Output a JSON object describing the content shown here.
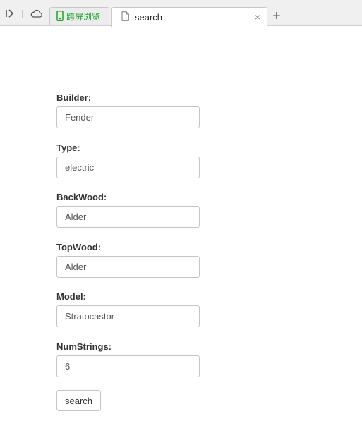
{
  "browser": {
    "qr_tab_label": "跨屏浏览",
    "active_tab_title": "search",
    "close_glyph": "×",
    "new_tab_glyph": "+"
  },
  "form": {
    "fields": [
      {
        "label": "Builder:",
        "value": "Fender"
      },
      {
        "label": "Type:",
        "value": "electric"
      },
      {
        "label": "BackWood:",
        "value": "Alder"
      },
      {
        "label": "TopWood:",
        "value": "Alder"
      },
      {
        "label": "Model:",
        "value": "Stratocastor"
      },
      {
        "label": "NumStrings:",
        "value": "6"
      }
    ],
    "submit_label": "search"
  },
  "colors": {
    "accent_green": "#1aa32a"
  }
}
